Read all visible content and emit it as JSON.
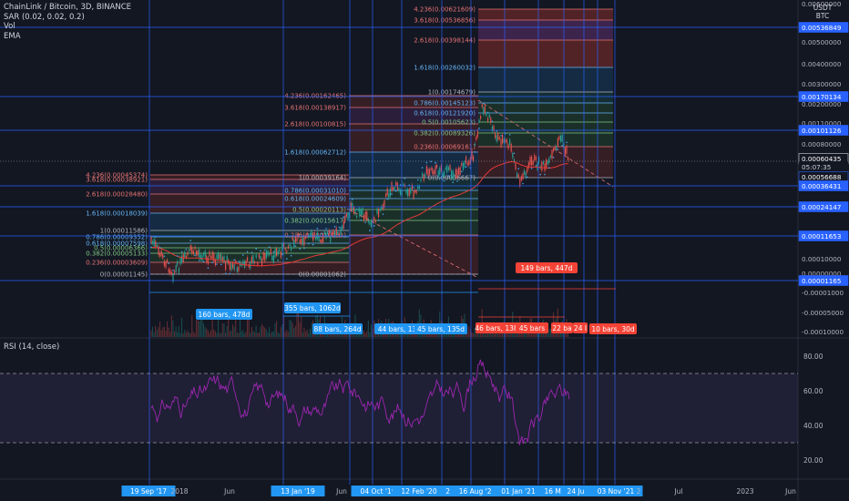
{
  "header": {
    "symbol_line": "ChainLink / Bitcoin, 3D, BINANCE",
    "indicators": [
      "SAR (0.02, 0.02, 0.2)",
      "Vol",
      "EMA"
    ],
    "rsi_label": "RSI (14, close)",
    "unit_top": "USDT",
    "unit_bottom": "BTC"
  },
  "colors": {
    "background": "#131722",
    "candle": "#d1d4dc",
    "vline": "#2962ff",
    "hline": "#2962ff",
    "rsi_line": "#9c27b0",
    "rsi_band": "#2a1f3d",
    "ema": "#e53935",
    "sar": "#42a5f5",
    "fib_red": "#e57373",
    "fib_blue": "#64b5f6",
    "fib_green": "#81c784",
    "label_blue": "#2196f3",
    "label_red": "#f44336"
  },
  "chart_data": [
    {
      "type": "line",
      "name": "price",
      "ylim": [
        -0.0001,
        0.00065
      ],
      "y_ticks": [
        "0.00600000",
        "0.00500000",
        "0.00400000",
        "0.00300000",
        "0.00200000",
        "0.00110000",
        "0.00080000",
        "0.00060000",
        "0.00040000",
        "0.00020000",
        "0.00010000",
        "0.00000000",
        "-0.00001000",
        "-0.00005000",
        "-0.00010000"
      ],
      "price_labels": [
        {
          "text": "0.00536849",
          "kind": "hline"
        },
        {
          "text": "0.00170134",
          "kind": "hline"
        },
        {
          "text": "0.00101126",
          "kind": "hline"
        },
        {
          "text": "0.00060435",
          "kind": "last"
        },
        {
          "text": "05:07:35",
          "kind": "countdown"
        },
        {
          "text": "0.00056688",
          "kind": "plain"
        },
        {
          "text": "0.00036431",
          "kind": "hline"
        },
        {
          "text": "0.00024147",
          "kind": "hline"
        },
        {
          "text": "0.00011653",
          "kind": "hline"
        },
        {
          "text": "0.00001165",
          "kind": "hline"
        }
      ],
      "x_labels": [
        "19 Sep '17",
        "2018",
        "Jun",
        "13 Jan '19",
        "Jun",
        "04 Oct '19",
        "12 Feb '20",
        "29",
        "16 Aug '20",
        "01 Jan '21",
        "16 Ma",
        "24 Ju",
        "0",
        "03 Nov '21",
        "2",
        "Jul",
        "2023",
        "Jun"
      ],
      "x_highlighted": [
        "19 Sep '17",
        "13 Jan '19",
        "04 Oct '19",
        "12 Feb '20",
        "29",
        "16 Aug '20",
        "01 Jan '21",
        "16 Ma",
        "24 Ju",
        "0",
        "03 Nov '21"
      ],
      "fib_sets": [
        {
          "levels": [
            {
              "text": "4.236(0.00045374)",
              "color": "fib_red"
            },
            {
              "text": "3.618(0.00038921)",
              "color": "fib_red"
            },
            {
              "text": "2.618(0.00028480)",
              "color": "fib_red"
            },
            {
              "text": "1.618(0.00018039)",
              "color": "fib_blue"
            },
            {
              "text": "1(0.00011586)",
              "color": "plain"
            },
            {
              "text": "0.786(0.00009352)",
              "color": "fib_blue"
            },
            {
              "text": "0.618(0.00007598)",
              "color": "fib_blue"
            },
            {
              "text": "0.5(0.00006366)",
              "color": "fib_green"
            },
            {
              "text": "0.382(0.00005133)",
              "color": "fib_green"
            },
            {
              "text": "0.236(0.00003609)",
              "color": "fib_red"
            },
            {
              "text": "0(0.00001145)",
              "color": "plain"
            }
          ]
        },
        {
          "levels": [
            {
              "text": "4.236(0.00162465)",
              "color": "fib_red"
            },
            {
              "text": "3.618(0.00138917)",
              "color": "fib_red"
            },
            {
              "text": "2.618(0.00100815)",
              "color": "fib_red"
            },
            {
              "text": "1.618(0.00062712)",
              "color": "fib_blue"
            },
            {
              "text": "1(0.00039164)",
              "color": "plain"
            },
            {
              "text": "0.786(0.00031010)",
              "color": "fib_blue"
            },
            {
              "text": "0.618(0.00024609)",
              "color": "fib_blue"
            },
            {
              "text": "0.5(0.00020113)",
              "color": "fib_green"
            },
            {
              "text": "0.382(0.00015617)",
              "color": "fib_green"
            },
            {
              "text": "0.236(0.00010053)",
              "color": "fib_red"
            },
            {
              "text": "0(0.00001062)",
              "color": "plain"
            }
          ]
        },
        {
          "levels": [
            {
              "text": "4.236(0.00621609)",
              "color": "fib_red"
            },
            {
              "text": "3.618(0.00536856)",
              "color": "fib_red"
            },
            {
              "text": "2.618(0.00398144)",
              "color": "fib_red"
            },
            {
              "text": "1.618(0.00260032)",
              "color": "fib_blue"
            },
            {
              "text": "1(0.00174679)",
              "color": "plain"
            },
            {
              "text": "0.786(0.00145123)",
              "color": "fib_blue"
            },
            {
              "text": "0.618(0.00121920)",
              "color": "fib_blue"
            },
            {
              "text": "0.5(0.00105623)",
              "color": "fib_green"
            },
            {
              "text": "0.382(0.00089326)",
              "color": "fib_green"
            },
            {
              "text": "0.236(0.00069161)",
              "color": "fib_red"
            },
            {
              "text": "0(0.00036667)",
              "color": "plain"
            }
          ]
        }
      ],
      "range_labels": [
        {
          "text": "160 bars, 478d",
          "color": "label_blue"
        },
        {
          "text": "355 bars, 1062d",
          "color": "label_blue"
        },
        {
          "text": "88 bars, 264d",
          "color": "label_blue"
        },
        {
          "text": "44 bars, 13",
          "color": "label_blue"
        },
        {
          "text": "45 bars, 135d",
          "color": "label_blue"
        },
        {
          "text": "149 bars, 447d",
          "color": "label_red"
        },
        {
          "text": "46 bars, 138",
          "color": "label_red"
        },
        {
          "text": "45 bars",
          "color": "label_red"
        },
        {
          "text": "22 ba",
          "color": "label_red"
        },
        {
          "text": "24 I",
          "color": "label_red"
        },
        {
          "text": "10 bars, 30d",
          "color": "label_red"
        }
      ]
    },
    {
      "type": "line",
      "name": "RSI (14, close)",
      "ylim": [
        10,
        90
      ],
      "y_ticks": [
        "80.00",
        "60.00",
        "40.00",
        "20.00"
      ],
      "bands": [
        30,
        70
      ]
    }
  ]
}
